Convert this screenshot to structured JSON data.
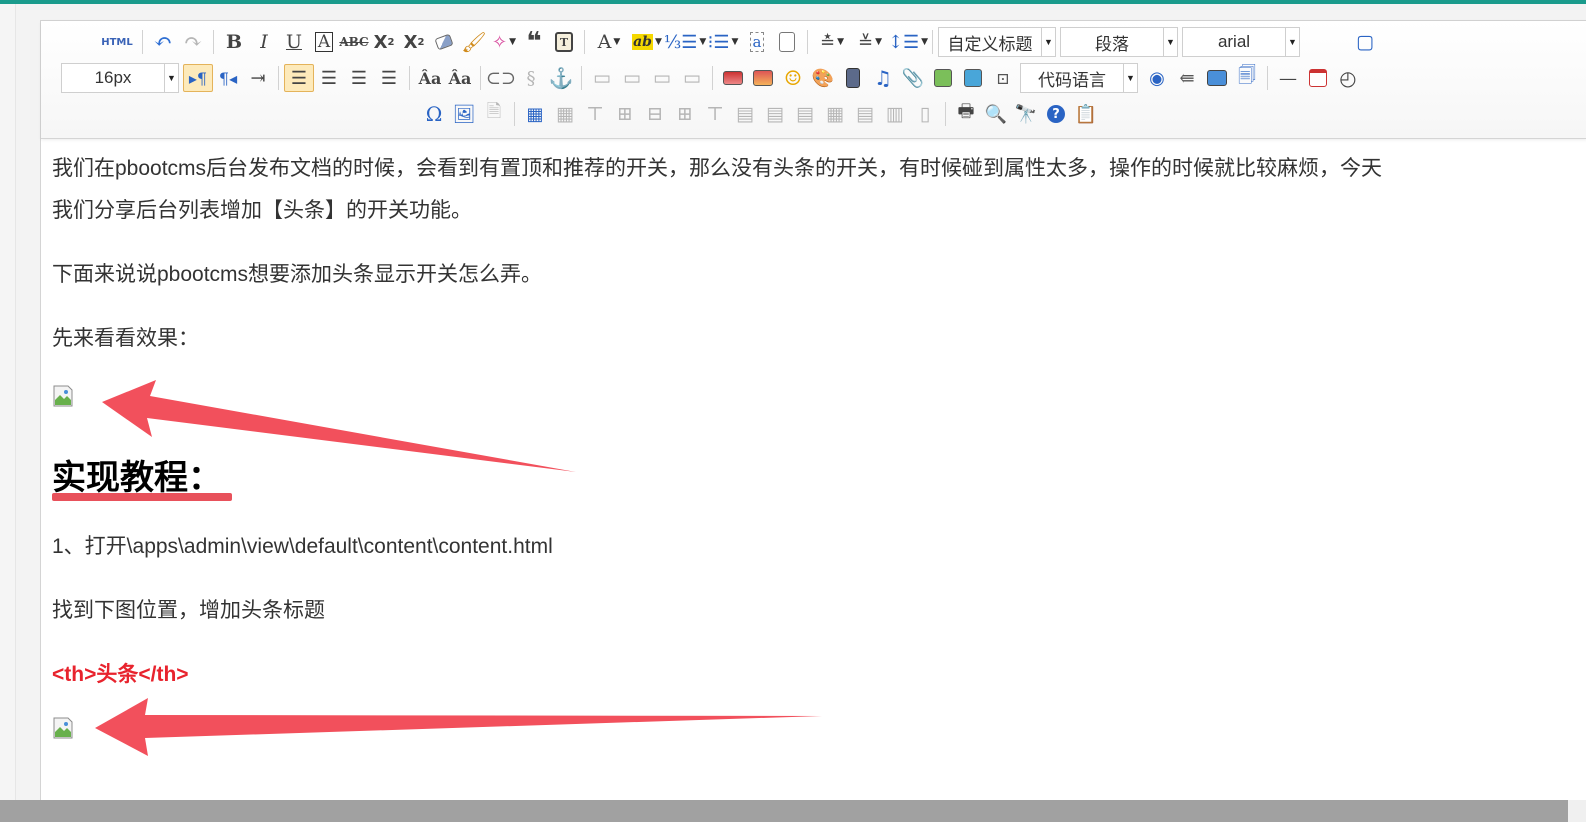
{
  "toolbar": {
    "html_label": "HTML",
    "heading_select": "自定义标题",
    "paragraph_select": "段落",
    "font_family_select": "arial",
    "font_size_select": "16px",
    "code_language_select": "代码语言"
  },
  "content": {
    "para1_line1": "我们在pbootcms后台发布文档的时候，会看到有置顶和推荐的开关，那么没有头条的开关，有时候碰到属性太多，操作的时候就比较麻烦，今天",
    "para1_line2": "我们分享后台列表增加【头条】的开关功能。",
    "para2": "下面来说说pbootcms想要添加头条显示开关怎么弄。",
    "para3": "先来看看效果：",
    "heading": "实现教程：",
    "step1": "1、打开\\apps\\admin\\view\\default\\content\\content.html",
    "step1_note": "找到下图位置，增加头条标题",
    "code_snippet": "<th>头条</th>"
  },
  "colors": {
    "accent_bar": "#1a9b8c",
    "arrow": "#f2505c",
    "code_red": "#e8232d"
  }
}
